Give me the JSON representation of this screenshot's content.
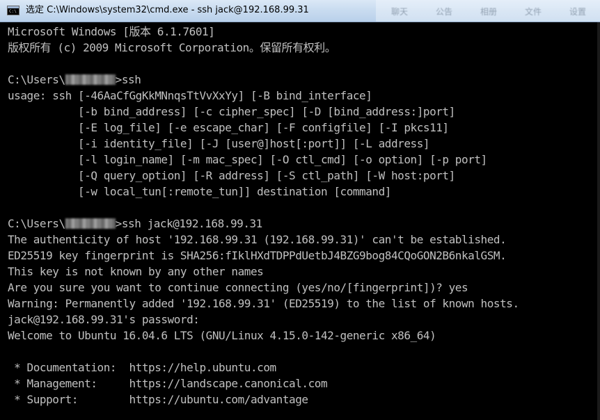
{
  "window": {
    "title": "选定 C:\\Windows\\system32\\cmd.exe - ssh  jack@192.168.99.31",
    "icon": "console-window-icon",
    "icon_text": "C:\\"
  },
  "background_app": {
    "tabs": [
      "聊天",
      "公告",
      "相册",
      "文件",
      "设置"
    ]
  },
  "console": {
    "lines": [
      {
        "text": "Microsoft Windows [版本 6.1.7601]"
      },
      {
        "text": "版权所有 (c) 2009 Microsoft Corporation。保留所有权利。"
      },
      {
        "text": ""
      },
      {
        "prefix": "C:\\Users\\",
        "redacted": true,
        "suffix": ">ssh"
      },
      {
        "text": "usage: ssh [-46AaCfGgKkMNnqsTtVvXxYy] [-B bind_interface]"
      },
      {
        "text": "           [-b bind_address] [-c cipher_spec] [-D [bind_address:]port]"
      },
      {
        "text": "           [-E log_file] [-e escape_char] [-F configfile] [-I pkcs11]"
      },
      {
        "text": "           [-i identity_file] [-J [user@]host[:port]] [-L address]"
      },
      {
        "text": "           [-l login_name] [-m mac_spec] [-O ctl_cmd] [-o option] [-p port]"
      },
      {
        "text": "           [-Q query_option] [-R address] [-S ctl_path] [-W host:port]"
      },
      {
        "text": "           [-w local_tun[:remote_tun]] destination [command]"
      },
      {
        "text": ""
      },
      {
        "prefix": "C:\\Users\\",
        "redacted": true,
        "suffix": ">ssh jack@192.168.99.31"
      },
      {
        "text": "The authenticity of host '192.168.99.31 (192.168.99.31)' can't be established."
      },
      {
        "text": "ED25519 key fingerprint is SHA256:fIklHXdTDPPdUetbJ4BZG9bog84CQoGON2B6nkalGSM."
      },
      {
        "text": "This key is not known by any other names"
      },
      {
        "text": "Are you sure you want to continue connecting (yes/no/[fingerprint])? yes"
      },
      {
        "text": "Warning: Permanently added '192.168.99.31' (ED25519) to the list of known hosts."
      },
      {
        "text": "jack@192.168.99.31's password:"
      },
      {
        "text": "Welcome to Ubuntu 16.04.6 LTS (GNU/Linux 4.15.0-142-generic x86_64)"
      },
      {
        "text": ""
      },
      {
        "text": " * Documentation:  https://help.ubuntu.com"
      },
      {
        "text": " * Management:     https://landscape.canonical.com"
      },
      {
        "text": " * Support:        https://ubuntu.com/advantage"
      }
    ]
  },
  "colors": {
    "console_background": "#000000",
    "console_text": "#c0c0c0",
    "titlebar": "#c9dcf0"
  }
}
